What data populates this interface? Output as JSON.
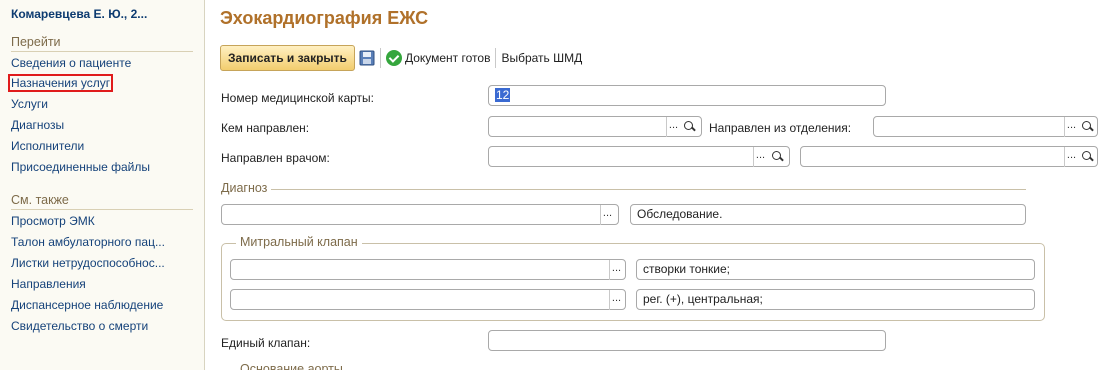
{
  "sidebar": {
    "patient": "Комаревцева Е. Ю., 2...",
    "goto_header": "Перейти",
    "goto_items": [
      "Сведения о пациенте",
      "Назначения услуг",
      "Услуги",
      "Диагнозы",
      "Исполнители",
      "Присоединенные файлы"
    ],
    "see_also_header": "См. также",
    "see_also_items": [
      "Просмотр ЭМК",
      "Талон амбулаторного пац...",
      "Листки нетрудоспособнос...",
      "Направления",
      "Диспансерное наблюдение",
      "Свидетельство о смерти"
    ]
  },
  "main": {
    "title": "Эхокардиография ЕЖС",
    "toolbar": {
      "save_close": "Записать и закрыть",
      "doc_ready": "Документ готов",
      "choose_template": "Выбрать ШМД"
    },
    "form": {
      "card_number_label": "Номер медицинской карты:",
      "card_number_value": "12",
      "referred_by_label": "Кем направлен:",
      "referred_by_value": "",
      "department_label": "Направлен из отделения:",
      "department_value": "",
      "doctor_label": "Направлен врачом:",
      "doctor_value": "",
      "doctor_value2": "",
      "diagnosis_group": "Диагноз",
      "diagnosis_value": "",
      "diagnosis_text": "Обследование.",
      "mitral_group": "Митральный клапан",
      "mitral_row1_value": "",
      "mitral_row1_text": "створки тонкие;",
      "mitral_row2_value": "",
      "mitral_row2_text": "рег. (+), центральная;",
      "single_valve_label": "Единый клапан:",
      "single_valve_value": "",
      "next_group": "Основание аорты"
    }
  },
  "colors": {
    "title": "#b0712a",
    "link": "#15427a",
    "highlight_box": "#e01b1b",
    "button_gold": "#f2cd6e",
    "selection": "#3a6ad2"
  }
}
